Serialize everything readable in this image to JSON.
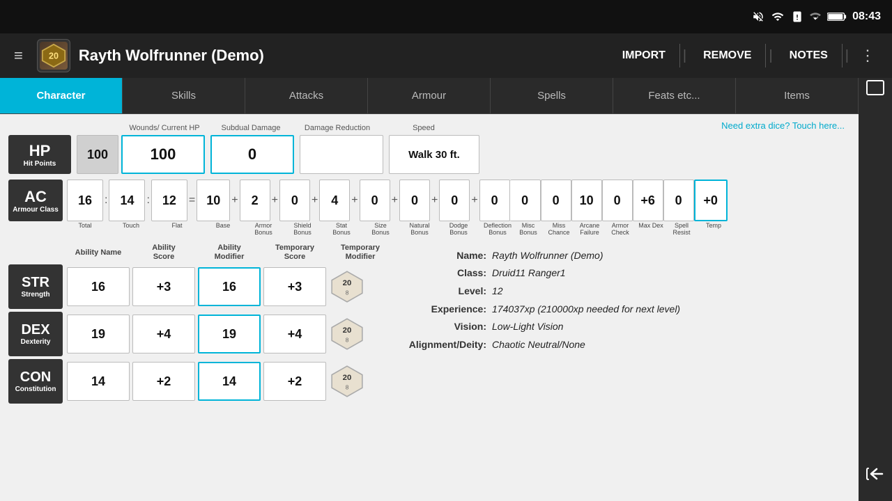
{
  "statusBar": {
    "time": "08:43",
    "icons": [
      "muted-icon",
      "wifi-icon",
      "sim-icon",
      "signal-icon",
      "battery-icon"
    ]
  },
  "appHeader": {
    "menuLabel": "≡",
    "logoText": "20",
    "title": "Rayth Wolfrunner (Demo)",
    "buttons": [
      "IMPORT",
      "REMOVE",
      "NOTES"
    ],
    "moreIcon": "⋮"
  },
  "tabs": [
    {
      "label": "Character",
      "active": true
    },
    {
      "label": "Skills",
      "active": false
    },
    {
      "label": "Attacks",
      "active": false
    },
    {
      "label": "Armour",
      "active": false
    },
    {
      "label": "Spells",
      "active": false
    },
    {
      "label": "Feats etc...",
      "active": false
    },
    {
      "label": "Items",
      "active": false
    }
  ],
  "hp": {
    "label": "HP",
    "sublabel": "Hit Points",
    "maxValue": "100",
    "currentHP": "100",
    "subDualDamage": "0",
    "damageReduction": "",
    "speed": "Walk 30 ft.",
    "headers": {
      "woundsCurrentHP": "Wounds/ Current HP",
      "subDualDamage": "Subdual Damage",
      "damageReduction": "Damage Reduction",
      "speed": "Speed"
    },
    "diceLink": "Need extra dice?  Touch here..."
  },
  "ac": {
    "label": "AC",
    "sublabel": "Armour Class",
    "values": {
      "total": "16",
      "touch": "14",
      "flat": "12",
      "base": "10",
      "armorBonus": "2",
      "shieldBonus": "0",
      "statBonus": "4",
      "sizeBonus": "0",
      "naturalBonus": "0",
      "dodgeBonus": "0",
      "deflectionBonus": "0",
      "miscBonus": "0",
      "missChance": "0",
      "arcaneFailure": "10",
      "armorCheck": "0",
      "maxDex": "+6",
      "spellResist": "0",
      "temp": "+0"
    },
    "labels": {
      "total": "Total",
      "touch": "Touch",
      "flat": "Flat",
      "base": "Base",
      "armorBonus": "Armor Bonus",
      "shieldBonus": "Shield Bonus",
      "statBonus": "Stat Bonus",
      "sizeBonus": "Size Bonus",
      "naturalBonus": "Natural Bonus",
      "dodgeBonus": "Dodge Bonus",
      "deflectionBonus": "Deflection Bonus",
      "miscBonus": "Misc Bonus",
      "missChance": "Miss Chance",
      "arcaneFailure": "Arcane Failure",
      "armorCheck": "Armor Check",
      "maxDex": "Max Dex",
      "spellResist": "Spell Resist",
      "temp": "Temp"
    }
  },
  "abilityHeaders": {
    "abilityName": "Ability Name",
    "abilityScore": "Ability Score",
    "abilityModifier": "Ability Modifier",
    "temporaryScore": "Temporary Score",
    "temporaryModifier": "Temporary Modifier"
  },
  "abilities": [
    {
      "abbr": "STR",
      "name": "Strength",
      "score": "16",
      "modifier": "+3",
      "tempScore": "16",
      "tempModifier": "+3"
    },
    {
      "abbr": "DEX",
      "name": "Dexterity",
      "score": "19",
      "modifier": "+4",
      "tempScore": "19",
      "tempModifier": "+4"
    },
    {
      "abbr": "CON",
      "name": "Constitution",
      "score": "14",
      "modifier": "+2",
      "tempScore": "14",
      "tempModifier": "+2"
    }
  ],
  "charInfo": {
    "name": {
      "label": "Name:",
      "value": "Rayth Wolfrunner (Demo)"
    },
    "class": {
      "label": "Class:",
      "value": "Druid11 Ranger1"
    },
    "level": {
      "label": "Level:",
      "value": "12"
    },
    "experience": {
      "label": "Experience:",
      "value": "174037xp (210000xp needed for next level)"
    },
    "vision": {
      "label": "Vision:",
      "value": "Low-Light Vision"
    },
    "alignment": {
      "label": "Alignment/Deity:",
      "value": "Chaotic Neutral/None"
    }
  },
  "sideNav": {
    "topIcon": "⬜",
    "backIcon": "↩"
  }
}
